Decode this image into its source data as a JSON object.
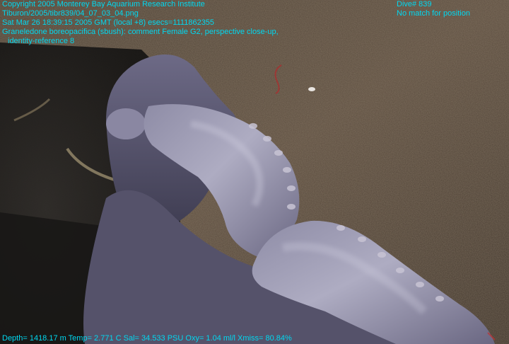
{
  "overlay": {
    "text_color": "#00d8f0",
    "copyright": "Copyright 2005 Monterey Bay Aquarium Research Institute",
    "image_path": "Tiburon/2005/tibr839/04_07_03_04.png",
    "timestamp": "Sat Mar 26 18:39:15 2005 GMT (local +8)  esecs=1111862355",
    "annotation": "Graneledone boreopacifica (sbush): comment Female G2, perspective close-up,",
    "identity": "identity-reference 8",
    "dive": "Dive# 839",
    "position_status": "No match for position",
    "telemetry": "Depth= 1418.17 m  Temp= 2.771 C  Sal= 34.533 PSU  Oxy= 1.04 ml/l  Xmiss= 80.84%"
  },
  "scene": {
    "subject": "octopus-graneledone-boreopacifica",
    "sediment_color": "#5a4a3c",
    "shadow_color": "#1e1c1a",
    "octopus_color": "#7c7892",
    "octopus_highlight": "#b4b2c8"
  }
}
